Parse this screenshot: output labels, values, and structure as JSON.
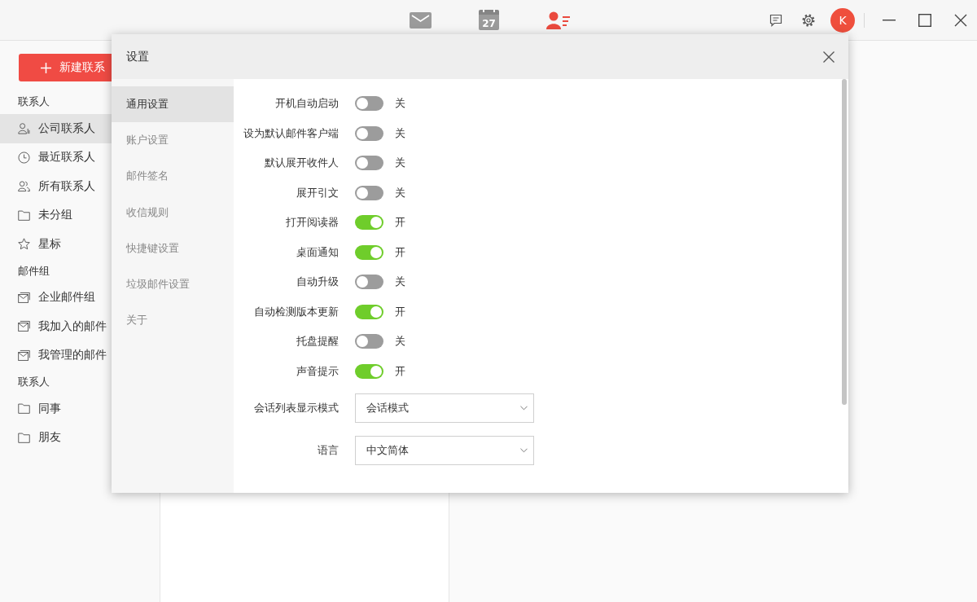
{
  "top_nav": [
    {
      "kind": "mail",
      "selected": false
    },
    {
      "kind": "calendar",
      "label": "27",
      "selected": false
    },
    {
      "kind": "contacts",
      "selected": true
    }
  ],
  "account": {
    "avatar_letter": "K"
  },
  "sidebar": {
    "new_button": "新建联系",
    "sections": [
      {
        "title": "联系人",
        "items": [
          {
            "label": "公司联系人",
            "kind": "company",
            "selected": true
          },
          {
            "label": "最近联系人",
            "kind": "recent",
            "selected": false
          },
          {
            "label": "所有联系人",
            "kind": "all",
            "selected": false
          },
          {
            "label": "未分组",
            "kind": "folder",
            "selected": false
          },
          {
            "label": "星标",
            "kind": "star",
            "selected": false
          }
        ]
      },
      {
        "title": "邮件组",
        "items": [
          {
            "label": "企业邮件组",
            "kind": "mailgroup",
            "selected": false
          },
          {
            "label": "我加入的邮件",
            "kind": "mailgroup",
            "selected": false
          },
          {
            "label": "我管理的邮件",
            "kind": "mailgroup",
            "selected": false
          }
        ]
      },
      {
        "title": "联系人",
        "items": [
          {
            "label": "同事",
            "kind": "folder",
            "selected": false
          },
          {
            "label": "朋友",
            "kind": "folder",
            "selected": false
          }
        ]
      }
    ]
  },
  "dialog": {
    "title": "设置",
    "nav": [
      {
        "label": "通用设置",
        "selected": true
      },
      {
        "label": "账户设置",
        "selected": false
      },
      {
        "label": "邮件签名",
        "selected": false
      },
      {
        "label": "收信规则",
        "selected": false
      },
      {
        "label": "快捷键设置",
        "selected": false
      },
      {
        "label": "垃圾邮件设置",
        "selected": false
      },
      {
        "label": "关于",
        "selected": false
      }
    ],
    "settings": [
      {
        "kind": "toggle",
        "label": "开机自动启动",
        "on": false,
        "state": "关"
      },
      {
        "kind": "toggle",
        "label": "设为默认邮件客户端",
        "on": false,
        "state": "关"
      },
      {
        "kind": "toggle",
        "label": "默认展开收件人",
        "on": false,
        "state": "关"
      },
      {
        "kind": "toggle",
        "label": "展开引文",
        "on": false,
        "state": "关"
      },
      {
        "kind": "toggle",
        "label": "打开阅读器",
        "on": true,
        "state": "开"
      },
      {
        "kind": "toggle",
        "label": "桌面通知",
        "on": true,
        "state": "开"
      },
      {
        "kind": "toggle",
        "label": "自动升级",
        "on": false,
        "state": "关"
      },
      {
        "kind": "toggle",
        "label": "自动检测版本更新",
        "on": true,
        "state": "开"
      },
      {
        "kind": "toggle",
        "label": "托盘提醒",
        "on": false,
        "state": "关"
      },
      {
        "kind": "toggle",
        "label": "声音提示",
        "on": true,
        "state": "开"
      },
      {
        "kind": "select",
        "label": "会话列表显示模式",
        "value": "会话模式"
      },
      {
        "kind": "select",
        "label": "语言",
        "value": "中文简体"
      }
    ]
  }
}
